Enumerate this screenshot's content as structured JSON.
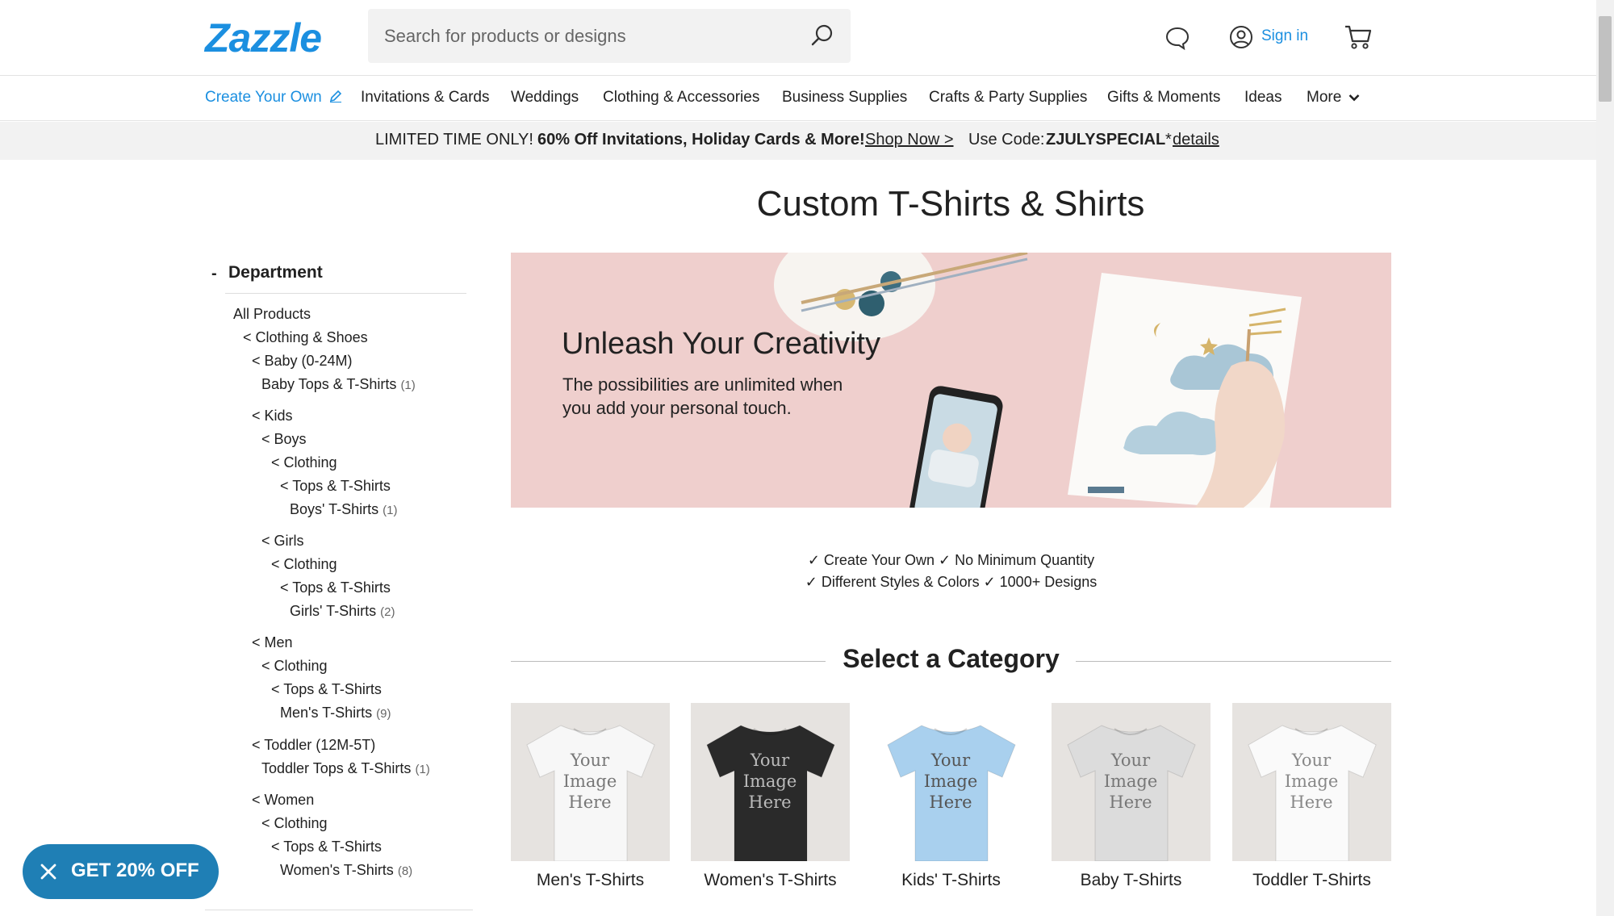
{
  "header": {
    "logo": "Zazzle",
    "search_placeholder": "Search for products or designs",
    "sign_in": "Sign in",
    "icons": [
      "search-icon",
      "chat-icon",
      "user-icon",
      "cart-icon"
    ]
  },
  "nav": {
    "items": [
      {
        "label": "Create Your Own",
        "accent": true
      },
      {
        "label": "Invitations & Cards"
      },
      {
        "label": "Weddings"
      },
      {
        "label": "Clothing & Accessories"
      },
      {
        "label": "Business Supplies"
      },
      {
        "label": "Crafts & Party Supplies"
      },
      {
        "label": "Gifts & Moments"
      },
      {
        "label": "Ideas"
      },
      {
        "label": "More"
      }
    ]
  },
  "promo": {
    "lead": "LIMITED TIME ONLY!",
    "offer": "60% Off Invitations, Holiday Cards & More!",
    "shop_now": "Shop Now >",
    "code_label": "Use Code:",
    "code": "ZJULYSPECIAL",
    "star": "*",
    "details": "details"
  },
  "page": {
    "title": "Custom T-Shirts & Shirts"
  },
  "sidebar": {
    "toggle": "-",
    "title": "Department",
    "items": [
      {
        "label": "All Products",
        "count": ""
      },
      {
        "label": "< Clothing & Shoes",
        "count": ""
      },
      {
        "label": "< Baby (0-24M)",
        "count": ""
      },
      {
        "label": "Baby Tops & T-Shirts",
        "count": "(1)"
      },
      {
        "label": "< Kids",
        "count": ""
      },
      {
        "label": "< Boys",
        "count": ""
      },
      {
        "label": "< Clothing",
        "count": ""
      },
      {
        "label": "< Tops & T-Shirts",
        "count": ""
      },
      {
        "label": "Boys' T-Shirts",
        "count": "(1)"
      },
      {
        "label": "< Girls",
        "count": ""
      },
      {
        "label": "< Clothing",
        "count": ""
      },
      {
        "label": "< Tops & T-Shirts",
        "count": ""
      },
      {
        "label": "Girls' T-Shirts",
        "count": "(2)"
      },
      {
        "label": "< Men",
        "count": ""
      },
      {
        "label": "< Clothing",
        "count": ""
      },
      {
        "label": "< Tops & T-Shirts",
        "count": ""
      },
      {
        "label": "Men's T-Shirts",
        "count": "(9)"
      },
      {
        "label": "< Toddler (12M-5T)",
        "count": ""
      },
      {
        "label": "Toddler Tops & T-Shirts",
        "count": "(1)"
      },
      {
        "label": "< Women",
        "count": ""
      },
      {
        "label": "< Clothing",
        "count": ""
      },
      {
        "label": "< Tops & T-Shirts",
        "count": ""
      },
      {
        "label": "Women's T-Shirts",
        "count": "(8)"
      }
    ]
  },
  "hero": {
    "headline": "Unleash Your Creativity",
    "sub_line1": "The possibilities are unlimited when",
    "sub_line2": "you add your personal touch."
  },
  "features": {
    "line1": "✓ Create Your Own ✓ No Minimum Quantity",
    "line2": "✓ Different Styles & Colors ✓ 1000+ Designs"
  },
  "category": {
    "title": "Select a Category",
    "tiles": [
      {
        "label": "Men's T-Shirts",
        "shirt_color": "#f7f7f7",
        "print_color": "#777777",
        "print_text": [
          "Your",
          "Image",
          "Here"
        ]
      },
      {
        "label": "Women's T-Shirts",
        "shirt_color": "#2a2a2a",
        "print_color": "#bbbbbb",
        "print_text": [
          "Your",
          "Image",
          "Here"
        ]
      },
      {
        "label": "Kids' T-Shirts",
        "shirt_color": "#a9d0ee",
        "print_color": "#555555",
        "print_text": [
          "Your",
          "Image",
          "Here"
        ]
      },
      {
        "label": "Baby T-Shirts",
        "shirt_color": "#dcdcdc",
        "print_color": "#777777",
        "print_text": [
          "Your",
          "Image",
          "Here"
        ]
      },
      {
        "label": "Toddler T-Shirts",
        "shirt_color": "#fafafa",
        "print_color": "#888888",
        "print_text": [
          "Your",
          "Image",
          "Here"
        ]
      }
    ]
  },
  "offer": {
    "label": "GET 20% OFF"
  },
  "colors": {
    "brand": "#1b8fe0",
    "offer_bg": "#1f7fb5",
    "hero_bg": "#efcfcd",
    "promo_bg": "#f2f2f2"
  }
}
